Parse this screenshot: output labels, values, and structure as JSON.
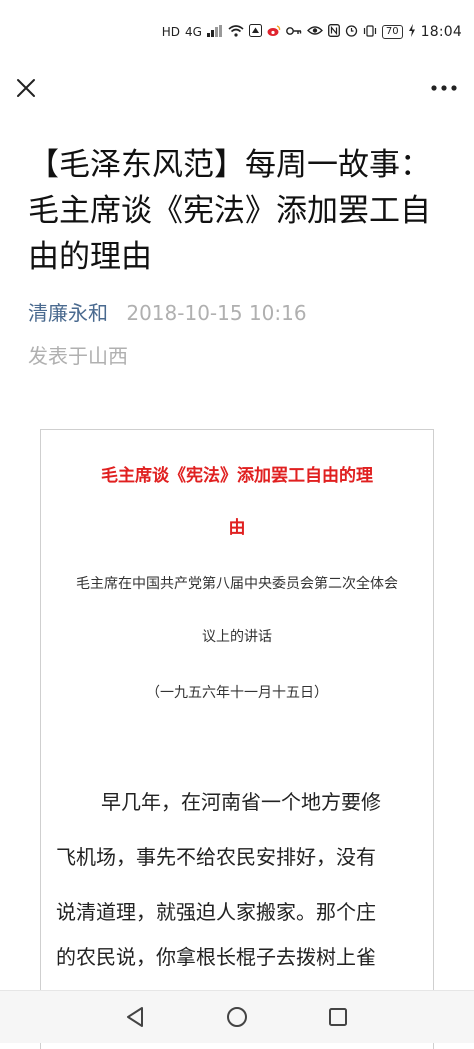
{
  "status_bar": {
    "network_label": "HD",
    "signal_label": "4G",
    "battery_level": "70",
    "time": "18:04"
  },
  "nav": {
    "close_icon": "close-icon",
    "more_icon": "more-icon"
  },
  "article": {
    "title": "【毛泽东风范】每周一故事：毛主席谈《宪法》添加罢工自由的理由",
    "author": "清廉永和",
    "date": "2018-10-15 10:16",
    "location": "发表于山西"
  },
  "box": {
    "title_line1": "毛主席谈《宪法》添加罢工自由的理",
    "title_line2": "由",
    "sub_line1": "毛主席在中国共产党第八届中央委员会第二次全体会",
    "sub_line2": "议上的讲话",
    "date_line": "（一九五六年十一月十五日）",
    "paragraph_lines": [
      "早几年，在河南省一个地方要修",
      "飞机场，事先不给农民安排好，没有",
      "说清道理，就强迫人家搬家。那个庄",
      "的农民说，你拿根长棍子去拨树上雀"
    ]
  },
  "system_nav": {
    "back_icon": "back-triangle-icon",
    "home_icon": "home-circle-icon",
    "recent_icon": "recent-square-icon"
  },
  "colors": {
    "author_blue": "#4a6a8f",
    "meta_gray": "#b0b0b0",
    "title_red": "#e02020"
  }
}
